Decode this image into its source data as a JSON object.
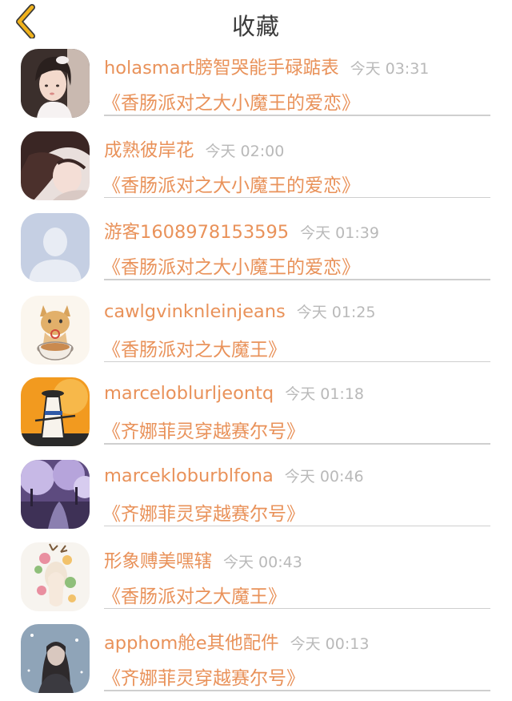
{
  "header": {
    "title": "收藏",
    "back_icon": "chevron-left-icon",
    "back_color": "#f0b21c"
  },
  "colors": {
    "accent": "#e9925a",
    "time": "#b9b9b9",
    "divider": "#cfcfcf"
  },
  "items": [
    {
      "name": "holasmart膀智哭能手碌踮表",
      "time": "今天 03:31",
      "title": "《香肠派对之大小魔王的爱恋》",
      "avatar": "girl-portrait-avatar"
    },
    {
      "name": "成熟彼岸花",
      "time": "今天 02:00",
      "title": "《香肠派对之大小魔王的爱恋》",
      "avatar": "girl-hair-avatar"
    },
    {
      "name": "游客1608978153595",
      "time": "今天 01:39",
      "title": "《香肠派对之大小魔王的爱恋》",
      "avatar": "default-user-avatar"
    },
    {
      "name": "cawlgvinknleinjeans",
      "time": "今天 01:25",
      "title": "《香肠派对之大魔王》",
      "avatar": "cat-teacup-avatar"
    },
    {
      "name": "marceloblurljeontq",
      "time": "今天 01:18",
      "title": "《齐娜菲灵穿越赛尔号》",
      "avatar": "samurai-avatar"
    },
    {
      "name": "marcekloburblfona",
      "time": "今天 00:46",
      "title": "《齐娜菲灵穿越赛尔号》",
      "avatar": "purple-trees-avatar"
    },
    {
      "name": "形象赙美嘿辖",
      "time": "今天 00:43",
      "title": "《香肠派对之大魔王》",
      "avatar": "deer-flowers-avatar"
    },
    {
      "name": "apphom舱e其他配件",
      "time": "今天 00:13",
      "title": "《齐娜菲灵穿越赛尔号》",
      "avatar": "winter-girl-avatar"
    }
  ]
}
